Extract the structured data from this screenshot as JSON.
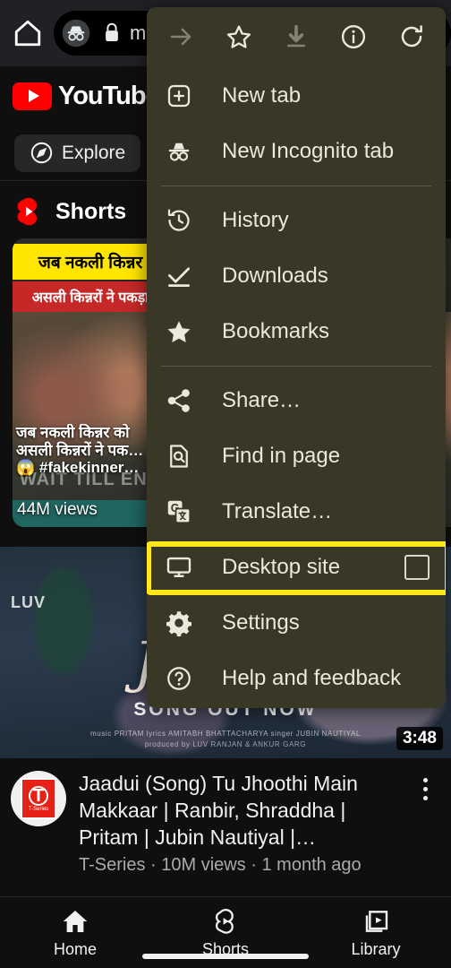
{
  "browser": {
    "home_icon": "home-icon",
    "incognito_icon": "incognito-icon",
    "lock_icon": "lock-icon",
    "url": "m"
  },
  "youtube": {
    "logo_text": "YouTube",
    "chips": [
      {
        "label": "Explore",
        "icon": "compass-icon"
      }
    ],
    "shorts_shelf": {
      "title": "Shorts",
      "icon": "shorts-logo-icon",
      "cards": [
        {
          "banner_yellow": "जब नकली किन्नर",
          "banner_red": "असली किन्नरों ने पकड़ा",
          "overlay_line1": "जब नकली किन्नर को",
          "overlay_line2": "असली किन्नरों ने पक…",
          "overlay_line3": "😱 #fakekinner…",
          "wait_text": "WAIT TILL END",
          "views": "44M views"
        }
      ]
    },
    "featured_video": {
      "watermark": "LUV",
      "title_art": "Jaadui",
      "subtitle_art": "SONG OUT NOW",
      "credits_line1": "music PRITAM  lyrics AMITABH BHATTACHARYA  singer JUBIN NAUTIYAL",
      "credits_line2": "produced by LUV RANJAN & ANKUR GARG",
      "duration": "3:48",
      "title": "Jaadui (Song) Tu Jhoothi Main Makkaar | Ranbir, Shraddha | Pritam | Jubin Nautiyal |…",
      "meta": "T-Series · 10M views · 1 month ago",
      "channel_avatar": "t-series-avatar",
      "menu_icon": "more-vert-icon"
    },
    "bottom_nav": [
      {
        "label": "Home",
        "icon": "home-icon"
      },
      {
        "label": "Shorts",
        "icon": "shorts-icon"
      },
      {
        "label": "Library",
        "icon": "library-icon"
      }
    ]
  },
  "menu": {
    "quick_actions": [
      {
        "name": "forward-arrow-icon",
        "label": "Forward",
        "disabled": true
      },
      {
        "name": "star-icon",
        "label": "Bookmark",
        "disabled": false
      },
      {
        "name": "download-icon",
        "label": "Download",
        "disabled": true
      },
      {
        "name": "info-icon",
        "label": "Page info",
        "disabled": false
      },
      {
        "name": "reload-icon",
        "label": "Reload",
        "disabled": false
      }
    ],
    "items": [
      {
        "label": "New tab",
        "icon": "new-tab-icon"
      },
      {
        "label": "New Incognito tab",
        "icon": "incognito-icon"
      },
      {
        "label": "History",
        "icon": "history-icon"
      },
      {
        "label": "Downloads",
        "icon": "downloads-check-icon"
      },
      {
        "label": "Bookmarks",
        "icon": "star-filled-icon"
      },
      {
        "label": "Share…",
        "icon": "share-icon"
      },
      {
        "label": "Find in page",
        "icon": "find-in-page-icon"
      },
      {
        "label": "Translate…",
        "icon": "translate-icon"
      },
      {
        "label": "Desktop site",
        "icon": "desktop-icon",
        "checkbox": false,
        "highlighted": true
      },
      {
        "label": "Settings",
        "icon": "gear-icon"
      },
      {
        "label": "Help and feedback",
        "icon": "help-icon"
      }
    ],
    "colors": {
      "background": "#393725",
      "text": "#ece8dd",
      "highlight": "#ffe81a",
      "divider": "#5d5a48"
    }
  }
}
